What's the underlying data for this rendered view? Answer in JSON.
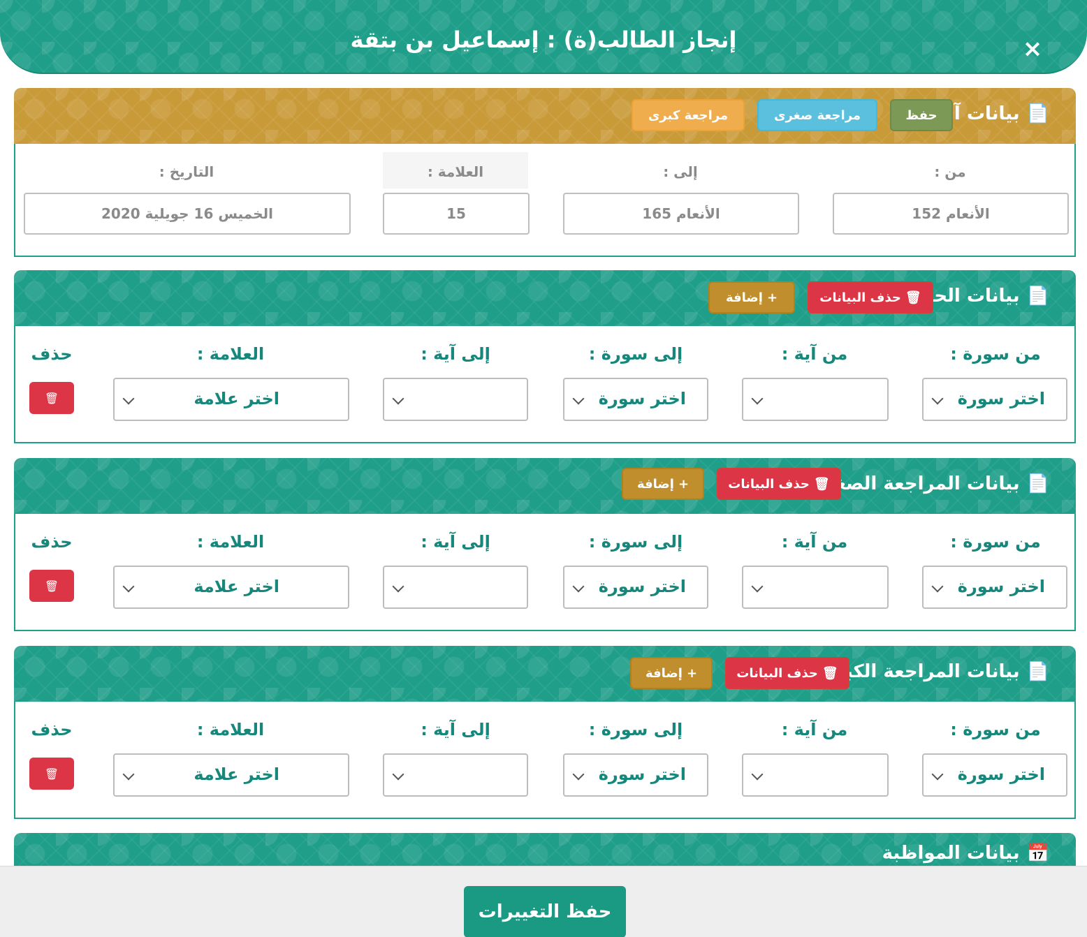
{
  "modal": {
    "title": "إنجاز الطالب(ة) : إسماعيل بن بتقة",
    "close": "×"
  },
  "last_data": {
    "title": "بيانات آخر :",
    "buttons": {
      "hifz": "حفظ",
      "minor_review": "مراجعة صغرى",
      "major_review": "مراجعة كبرى"
    },
    "labels": {
      "from": "من :",
      "to": "إلى :",
      "grade": "العلامة :",
      "date": "التاريخ :"
    },
    "values": {
      "from": "الأنعام 152",
      "to": "الأنعام 165",
      "grade": "15",
      "date": "الخميس 16 جويلية 2020"
    }
  },
  "sections": {
    "hifz": {
      "title": "بيانات الحفظ",
      "delete_data": "حذف البيانات",
      "add": "إضافة"
    },
    "minor": {
      "title": "بيانات المراجعة الصغرى",
      "delete_data": "حذف البيانات",
      "add": "إضافة"
    },
    "major": {
      "title": "بيانات المراجعة الكبرى",
      "delete_data": "حذف البيانات",
      "add": "إضافة"
    },
    "attendance": {
      "title": "بيانات المواظبة"
    }
  },
  "row_labels": {
    "from_sura": "من سورة :",
    "from_aya": "من آية :",
    "to_sura": "إلى سورة :",
    "to_aya": "إلى آية :",
    "grade": "العلامة :",
    "delete": "حذف"
  },
  "row_values": {
    "sura_placeholder": "اختر سورة",
    "grade_placeholder": "اختر علامة"
  },
  "footer": {
    "save": "حفظ التغييرات"
  },
  "colors": {
    "teal": "#1f9e89",
    "gold": "#c99a38",
    "red": "#dc3545",
    "green": "#7c9a55",
    "blue": "#5bc0de",
    "orange": "#f0ad4e"
  },
  "icons": [
    "file-icon",
    "trash-icon",
    "plus-icon",
    "calendar-icon",
    "chevron-down-icon",
    "close-icon"
  ]
}
